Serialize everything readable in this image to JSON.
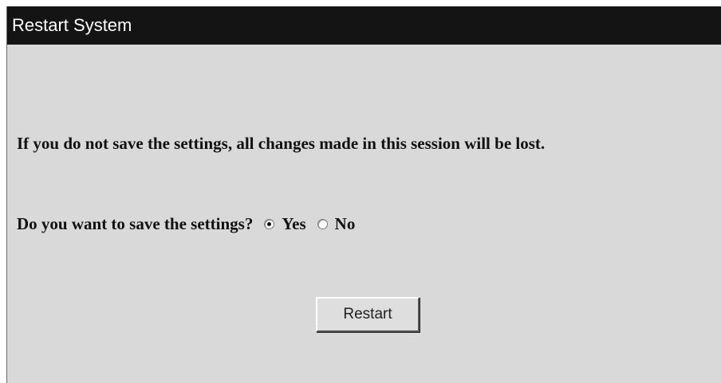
{
  "window": {
    "title": "Restart System"
  },
  "content": {
    "message": "If you do not save the settings, all changes made in this session will be lost.",
    "question": "Do you want to save the settings?",
    "options": [
      {
        "label": "Yes",
        "selected": true
      },
      {
        "label": "No",
        "selected": false
      }
    ],
    "restart_label": "Restart"
  }
}
